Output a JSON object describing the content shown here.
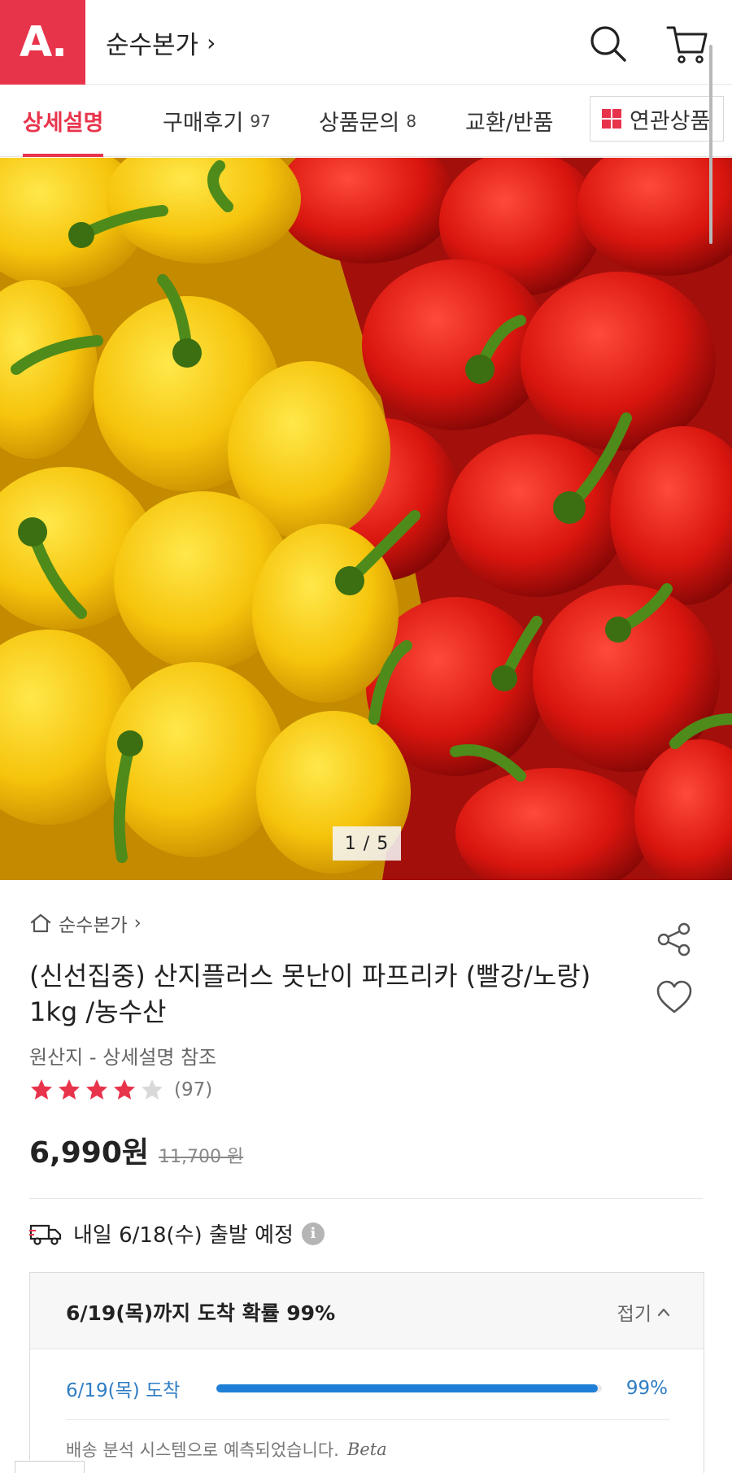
{
  "header": {
    "logo_text": "A.",
    "store_name": "순수본가",
    "chevron": "›",
    "icons": [
      "search-icon",
      "cart-icon"
    ]
  },
  "tabs": [
    {
      "label": "상세설명",
      "count": "",
      "active": true
    },
    {
      "label": "구매후기",
      "count": "97",
      "active": false
    },
    {
      "label": "상품문의",
      "count": "8",
      "active": false
    },
    {
      "label": "교환/반품",
      "count": "",
      "active": false
    }
  ],
  "related_tab": {
    "label": "연관상품"
  },
  "image": {
    "counter": "1 / 5"
  },
  "product": {
    "store_crumb": "순수본가",
    "crumb_chevron": "›",
    "title": "(신선집중) 산지플러스 못난이 파프리카 (빨강/노랑) 1kg /농수산",
    "origin": "원산지 - 상세설명 참조",
    "rating_value": 4,
    "rating_max": 5,
    "rating_count": "(97)",
    "price": "6,990원",
    "original_price": "11,700 원"
  },
  "shipping": {
    "text": "내일 6/18(수) 출발 예정",
    "info": "i"
  },
  "delivery": {
    "title": "6/19(목)까지 도착 확률 99%",
    "toggle_label": "접기",
    "row_date": "6/19(목) 도착",
    "row_pct": "99%",
    "row_fraction": 0.99,
    "note": "배송 분석 시스템으로 예측되었습니다.",
    "beta": "Beta"
  },
  "colors": {
    "brand": "#e8344b",
    "progress": "#1f7fd6",
    "delivery_text": "#2f7dc4"
  }
}
